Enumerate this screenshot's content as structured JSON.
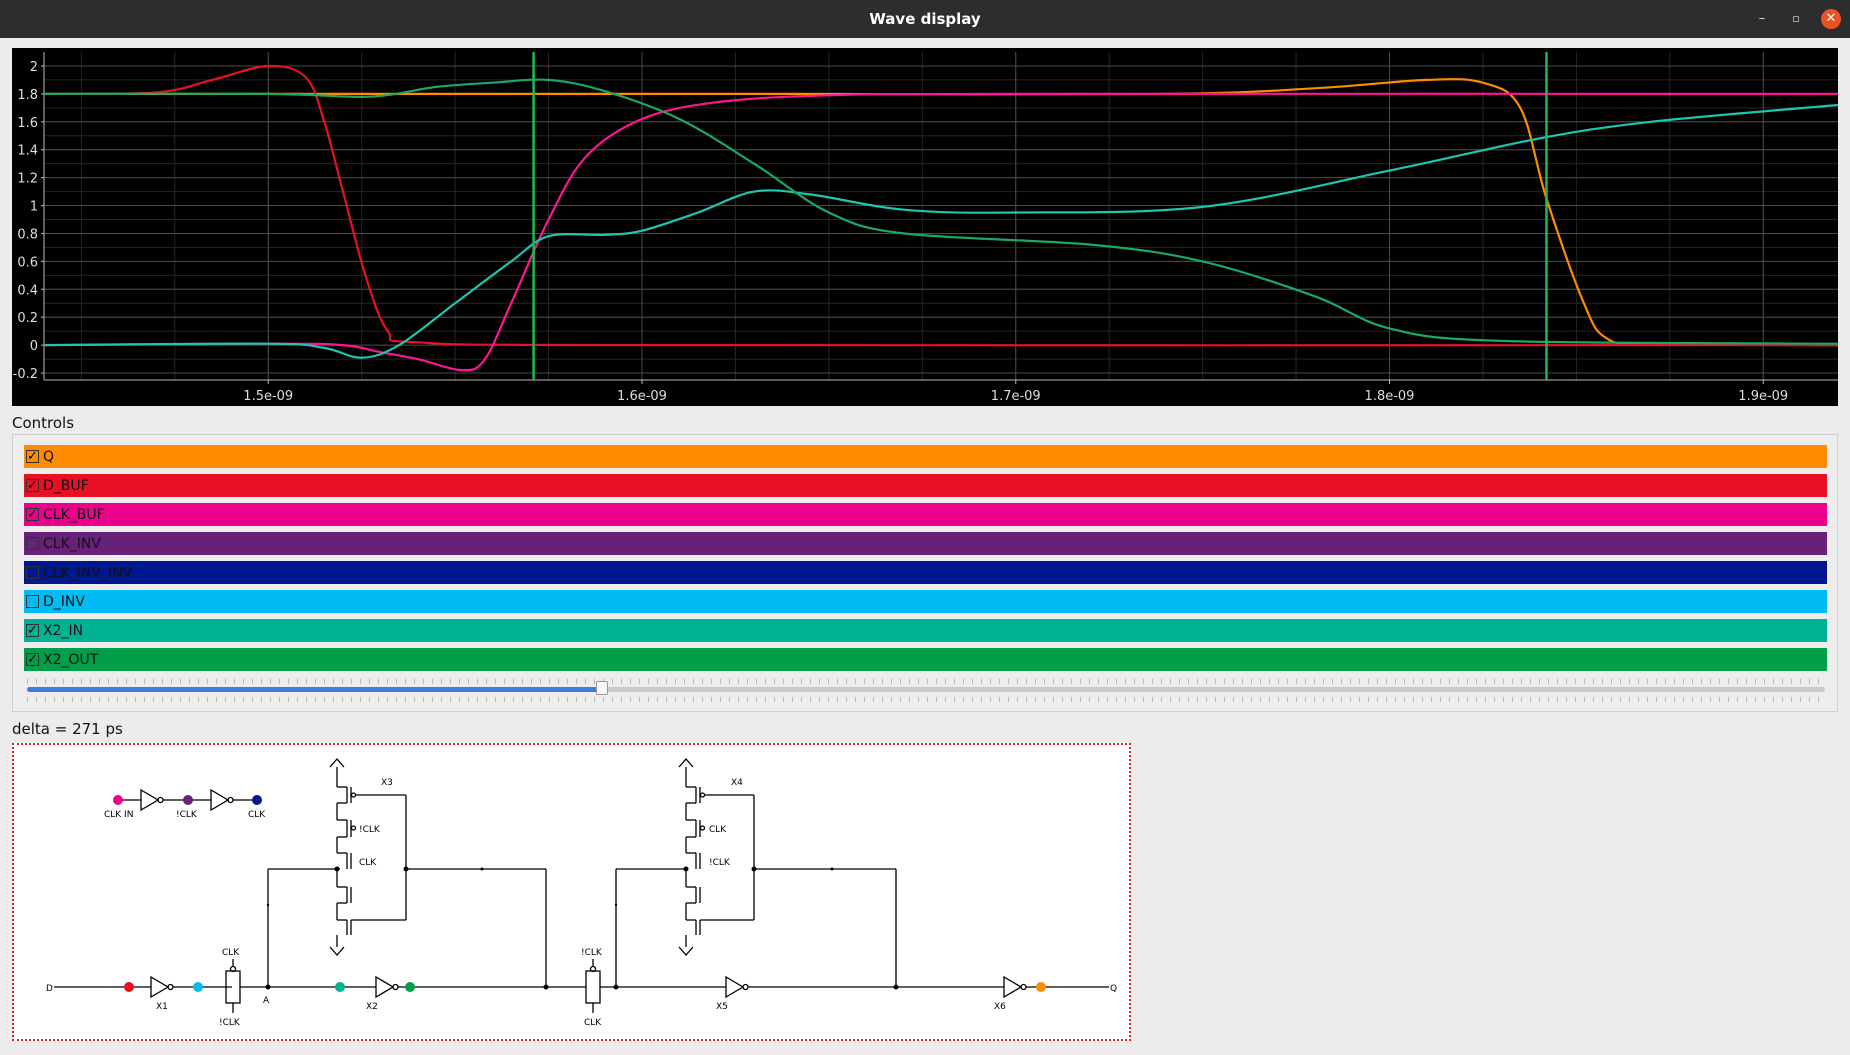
{
  "window": {
    "title": "Wave display",
    "buttons": {
      "minimize": "–",
      "maximize": "▫",
      "close": "✕"
    }
  },
  "chart_data": {
    "type": "line",
    "xlim": [
      1.44e-09,
      1.92e-09
    ],
    "ylim": [
      -0.25,
      2.1
    ],
    "y_ticks": [
      2,
      1.8,
      1.6,
      1.4,
      1.2,
      1,
      0.8,
      0.6,
      0.4,
      0.2,
      0,
      -0.2
    ],
    "y_tick_labels": [
      "2",
      "1.8",
      "1.6",
      "1.4",
      "1.2",
      "1",
      "0.8",
      "0.6",
      "0.4",
      "0.2",
      "0",
      "-0.2"
    ],
    "x_ticks": [
      1.5e-09,
      1.6e-09,
      1.7e-09,
      1.8e-09,
      1.9e-09
    ],
    "x_tick_labels": [
      "1.5e-09",
      "1.6e-09",
      "1.7e-09",
      "1.8e-09",
      "1.9e-09"
    ],
    "grid": true,
    "background": "#000000",
    "cursors": [
      1.571e-09,
      1.842e-09
    ],
    "cursor_color": "#1db954",
    "series": [
      {
        "name": "Q",
        "color": "#ff8c00",
        "points": [
          [
            1.44e-09,
            1.8
          ],
          [
            1.58e-09,
            1.8
          ],
          [
            1.64e-09,
            1.8
          ],
          [
            1.74e-09,
            1.8
          ],
          [
            1.78e-09,
            1.84
          ],
          [
            1.81e-09,
            1.9
          ],
          [
            1.825e-09,
            1.88
          ],
          [
            1.835e-09,
            1.7
          ],
          [
            1.842e-09,
            1.05
          ],
          [
            1.852e-09,
            0.3
          ],
          [
            1.858e-09,
            0.05
          ],
          [
            1.87e-09,
            0.01
          ],
          [
            1.92e-09,
            0.0
          ]
        ]
      },
      {
        "name": "D_BUF",
        "color": "#e81123",
        "points": [
          [
            1.44e-09,
            1.8
          ],
          [
            1.47e-09,
            1.81
          ],
          [
            1.485e-09,
            1.9
          ],
          [
            1.5e-09,
            2.0
          ],
          [
            1.51e-09,
            1.92
          ],
          [
            1.515e-09,
            1.6
          ],
          [
            1.52e-09,
            1.1
          ],
          [
            1.526e-09,
            0.5
          ],
          [
            1.532e-09,
            0.1
          ],
          [
            1.54e-09,
            0.02
          ],
          [
            1.6e-09,
            0.0
          ],
          [
            1.92e-09,
            0.0
          ]
        ]
      },
      {
        "name": "CLK_BUF",
        "color": "#ff1493",
        "points": [
          [
            1.44e-09,
            0.0
          ],
          [
            1.5e-09,
            0.01
          ],
          [
            1.52e-09,
            0.0
          ],
          [
            1.53e-09,
            -0.05
          ],
          [
            1.54e-09,
            -0.1
          ],
          [
            1.552e-09,
            -0.18
          ],
          [
            1.558e-09,
            -0.1
          ],
          [
            1.565e-09,
            0.3
          ],
          [
            1.575e-09,
            0.9
          ],
          [
            1.585e-09,
            1.35
          ],
          [
            1.6e-09,
            1.62
          ],
          [
            1.62e-09,
            1.74
          ],
          [
            1.65e-09,
            1.79
          ],
          [
            1.7e-09,
            1.8
          ],
          [
            1.92e-09,
            1.8
          ]
        ]
      },
      {
        "name": "X2_IN",
        "color": "#20c4b0",
        "points": [
          [
            1.44e-09,
            0.0
          ],
          [
            1.5e-09,
            0.01
          ],
          [
            1.515e-09,
            -0.02
          ],
          [
            1.525e-09,
            -0.09
          ],
          [
            1.535e-09,
            0.0
          ],
          [
            1.55e-09,
            0.3
          ],
          [
            1.565e-09,
            0.6
          ],
          [
            1.575e-09,
            0.78
          ],
          [
            1.59e-09,
            0.79
          ],
          [
            1.6e-09,
            0.82
          ],
          [
            1.615e-09,
            0.95
          ],
          [
            1.63e-09,
            1.1
          ],
          [
            1.645e-09,
            1.08
          ],
          [
            1.67e-09,
            0.97
          ],
          [
            1.7e-09,
            0.95
          ],
          [
            1.75e-09,
            0.99
          ],
          [
            1.8e-09,
            1.25
          ],
          [
            1.84e-09,
            1.48
          ],
          [
            1.87e-09,
            1.6
          ],
          [
            1.92e-09,
            1.72
          ]
        ]
      },
      {
        "name": "X2_OUT",
        "color": "#1aa865",
        "points": [
          [
            1.44e-09,
            1.8
          ],
          [
            1.5e-09,
            1.8
          ],
          [
            1.527e-09,
            1.78
          ],
          [
            1.545e-09,
            1.85
          ],
          [
            1.56e-09,
            1.88
          ],
          [
            1.575e-09,
            1.9
          ],
          [
            1.59e-09,
            1.82
          ],
          [
            1.61e-09,
            1.62
          ],
          [
            1.63e-09,
            1.3
          ],
          [
            1.65e-09,
            0.95
          ],
          [
            1.67e-09,
            0.8
          ],
          [
            1.72e-09,
            0.72
          ],
          [
            1.75e-09,
            0.6
          ],
          [
            1.78e-09,
            0.35
          ],
          [
            1.8e-09,
            0.12
          ],
          [
            1.83e-09,
            0.03
          ],
          [
            1.92e-09,
            0.01
          ]
        ]
      }
    ]
  },
  "controls": {
    "title": "Controls",
    "signals": [
      {
        "name": "Q",
        "checked": true,
        "color": "#ff8c00"
      },
      {
        "name": "D_BUF",
        "checked": true,
        "color": "#e81123"
      },
      {
        "name": "CLK_BUF",
        "checked": true,
        "color": "#ec008c"
      },
      {
        "name": "CLK_INV",
        "checked": false,
        "color": "#68217a"
      },
      {
        "name": "CLK_INV_INV",
        "checked": false,
        "color": "#00188f"
      },
      {
        "name": "D_INV",
        "checked": false,
        "color": "#00bcf2"
      },
      {
        "name": "X2_IN",
        "checked": true,
        "color": "#00b294"
      },
      {
        "name": "X2_OUT",
        "checked": true,
        "color": "#009e49"
      }
    ],
    "slider_value": 0.32
  },
  "delta": {
    "text": "delta = 271 ps"
  },
  "schematic": {
    "labels": {
      "clk_in": "CLK IN",
      "nclk": "!CLK",
      "clk": "CLK",
      "d": "D",
      "q": "Q",
      "a": "A",
      "x1": "X1",
      "x2": "X2",
      "x3": "X3",
      "x4": "X4",
      "x5": "X5",
      "x6": "X6"
    }
  }
}
